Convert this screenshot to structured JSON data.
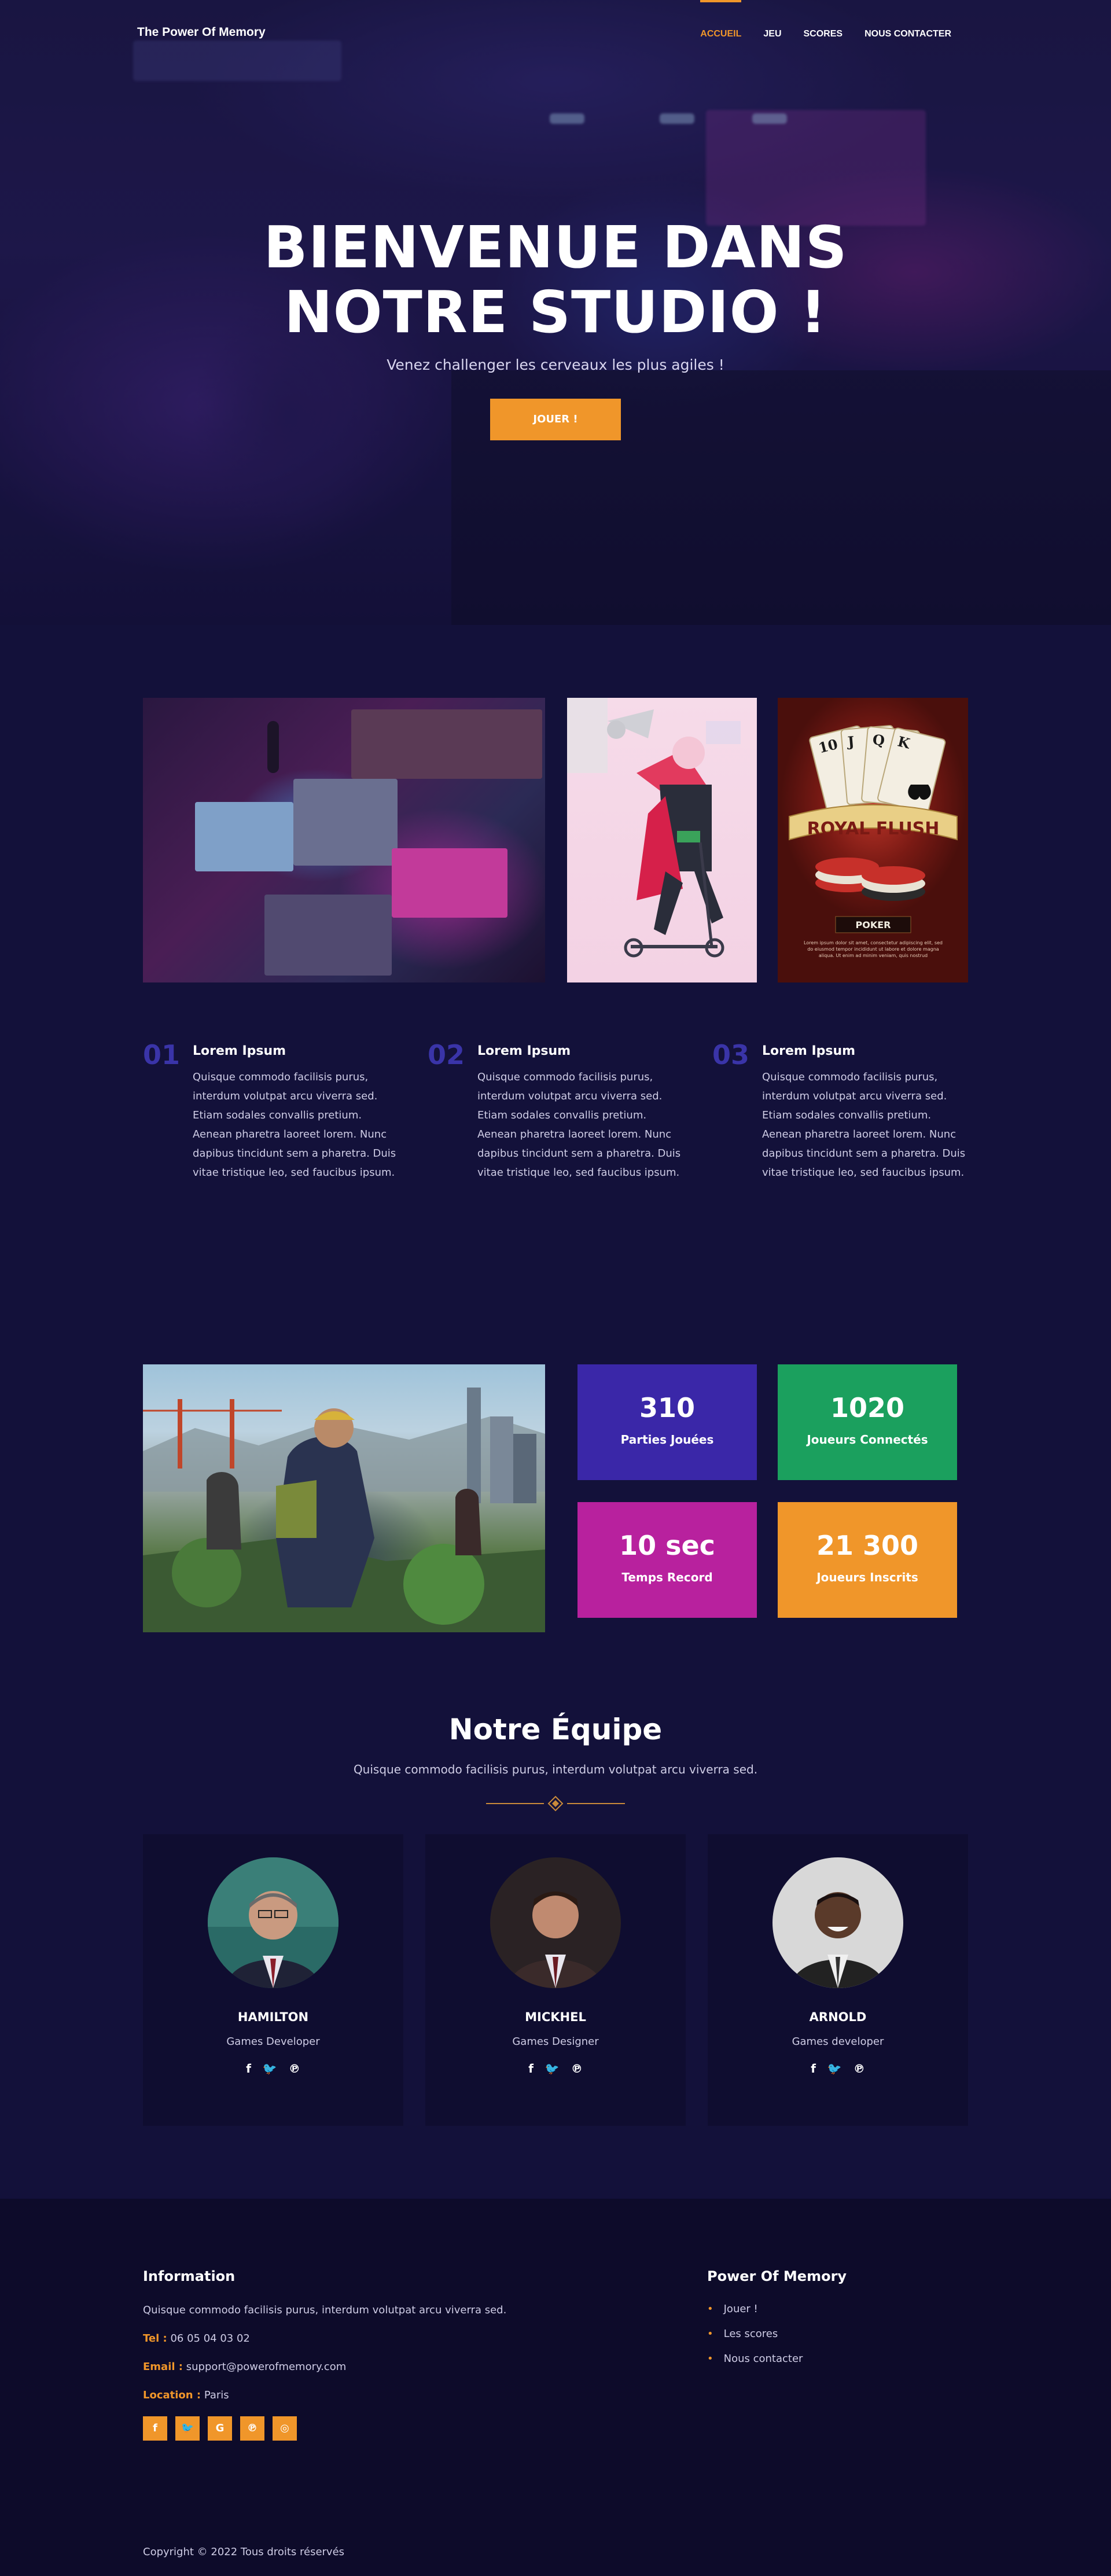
{
  "nav": {
    "brand": "The Power Of Memory",
    "links": [
      "Accueil",
      "Jeu",
      "Scores",
      "Nous contacter"
    ],
    "active_color": "#f0962a"
  },
  "hero": {
    "title_line1": "BIENVENUE DANS",
    "title_line2": "NOTRE STUDIO !",
    "subtitle": "Venez challenger les cerveaux les plus agiles !",
    "button": "JOUER !"
  },
  "features": [
    {
      "num": "01",
      "title": "Lorem Ipsum",
      "text": "Quisque commodo facilisis purus, interdum volutpat arcu viverra sed. Etiam sodales convallis pretium. Aenean pharetra laoreet lorem. Nunc dapibus tincidunt sem a pharetra. Duis vitae tristique leo, sed faucibus ipsum."
    },
    {
      "num": "02",
      "title": "Lorem Ipsum",
      "text": "Quisque commodo facilisis purus, interdum volutpat arcu viverra sed. Etiam sodales convallis pretium. Aenean pharetra laoreet lorem. Nunc dapibus tincidunt sem a pharetra. Duis vitae tristique leo, sed faucibus ipsum."
    },
    {
      "num": "03",
      "title": "Lorem Ipsum",
      "text": "Quisque commodo facilisis purus, interdum volutpat arcu viverra sed. Etiam sodales convallis pretium. Aenean pharetra laoreet lorem. Nunc dapibus tincidunt sem a pharetra. Duis vitae tristique leo, sed faucibus ipsum."
    }
  ],
  "poker_card": {
    "banner": "ROYAL FLUSH",
    "label": "POKER",
    "fine_print": "Lorem ipsum dolor sit amet, consectetur adipiscing elit, sed do eiusmod tempor incididunt ut labore et dolore magna aliqua. Ut enim ad minim veniam, quis nostrud"
  },
  "stats": [
    {
      "value": "310",
      "label": "Parties Jouées",
      "color": "#3a27a8"
    },
    {
      "value": "1020",
      "label": "Joueurs Connectés",
      "color": "#1ba05e"
    },
    {
      "value": "10 sec",
      "label": "Temps Record",
      "color": "#b8219e"
    },
    {
      "value": "21 300",
      "label": "Joueurs Inscrits",
      "color": "#f0962a"
    }
  ],
  "team": {
    "title": "Notre Équipe",
    "subtitle": "Quisque commodo facilisis purus, interdum volutpat arcu viverra sed.",
    "members": [
      {
        "name": "HAMILTON",
        "role": "Games Developer"
      },
      {
        "name": "MICKHEL",
        "role": "Games Designer"
      },
      {
        "name": "ARNOLD",
        "role": "Games developer"
      }
    ],
    "social_icons": [
      "facebook-icon",
      "twitter-icon",
      "pinterest-icon"
    ]
  },
  "footer": {
    "info_title": "Information",
    "info_text": "Quisque commodo facilisis purus, interdum volutpat arcu viverra sed.",
    "tel_label": "Tel :",
    "tel_value": "06 05 04 03 02",
    "email_label": "Email :",
    "email_value": "support@powerofmemory.com",
    "location_label": "Location :",
    "location_value": "Paris",
    "social_icons": [
      "facebook-icon",
      "twitter-icon",
      "google-icon",
      "pinterest-icon",
      "instagram-icon"
    ],
    "links_title": "Power Of Memory",
    "links": [
      "Jouer !",
      "Les scores",
      "Nous contacter"
    ],
    "copyright": "Copyright © 2022 Tous droits réservés"
  },
  "colors": {
    "accent": "#f0962a",
    "background": "#13113a",
    "number": "#3a34a8"
  }
}
